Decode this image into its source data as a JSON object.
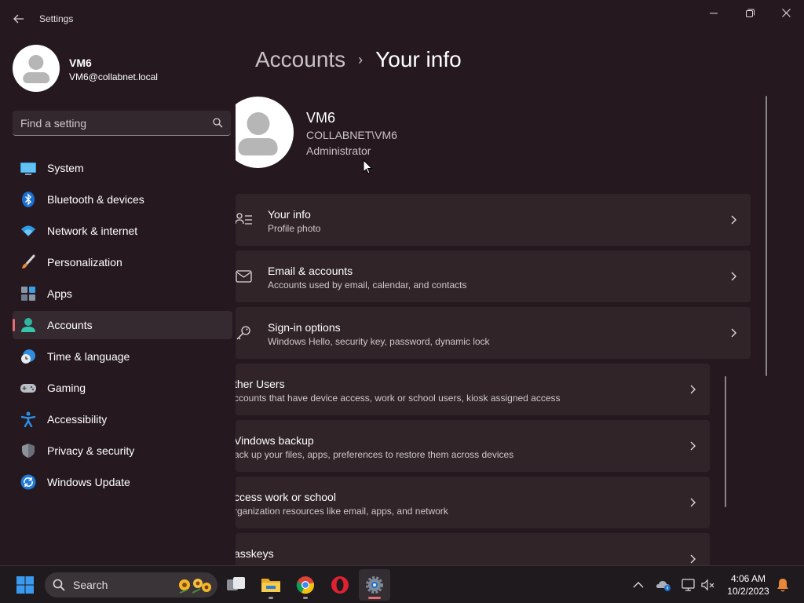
{
  "window": {
    "title": "Settings"
  },
  "profile": {
    "name": "VM6",
    "email": "VM6@collabnet.local"
  },
  "search": {
    "placeholder": "Find a setting"
  },
  "nav": {
    "items": [
      {
        "label": "System",
        "icon": "monitor-icon"
      },
      {
        "label": "Bluetooth & devices",
        "icon": "bluetooth-icon"
      },
      {
        "label": "Network & internet",
        "icon": "wifi-icon"
      },
      {
        "label": "Personalization",
        "icon": "paintbrush-icon"
      },
      {
        "label": "Apps",
        "icon": "apps-grid-icon"
      },
      {
        "label": "Accounts",
        "icon": "person-icon",
        "selected": true
      },
      {
        "label": "Time & language",
        "icon": "globe-clock-icon"
      },
      {
        "label": "Gaming",
        "icon": "gamepad-icon"
      },
      {
        "label": "Accessibility",
        "icon": "accessibility-icon"
      },
      {
        "label": "Privacy & security",
        "icon": "shield-icon"
      },
      {
        "label": "Windows Update",
        "icon": "update-icon"
      }
    ]
  },
  "breadcrumb": {
    "parent": "Accounts",
    "separator": "›",
    "current": "Your info"
  },
  "user": {
    "name": "VM6",
    "domain": "COLLABNET\\VM6",
    "role": "Administrator"
  },
  "cards": [
    {
      "title": "Your info",
      "subtitle": "Profile photo",
      "icon": "profile-card-icon"
    },
    {
      "title": "Email & accounts",
      "subtitle": "Accounts used by email, calendar, and contacts",
      "icon": "mail-icon"
    },
    {
      "title": "Sign-in options",
      "subtitle": "Windows Hello, security key, password, dynamic lock",
      "icon": "key-icon"
    },
    {
      "title": "ther Users",
      "subtitle": "ccounts that have device access, work or school users, kiosk assigned access"
    },
    {
      "title": "Vindows backup",
      "subtitle": "ack up your files, apps, preferences to restore them across devices"
    },
    {
      "title": "ccess work or school",
      "subtitle": "rganization resources like email, apps, and network"
    },
    {
      "title": "asskeys",
      "subtitle": ""
    }
  ],
  "taskbar": {
    "search_label": "Search",
    "time": "4:06 AM",
    "date": "10/2/2023"
  },
  "colors": {
    "accent": "#e26d72",
    "window_bg": "#25191f",
    "card_bg": "#302429"
  }
}
